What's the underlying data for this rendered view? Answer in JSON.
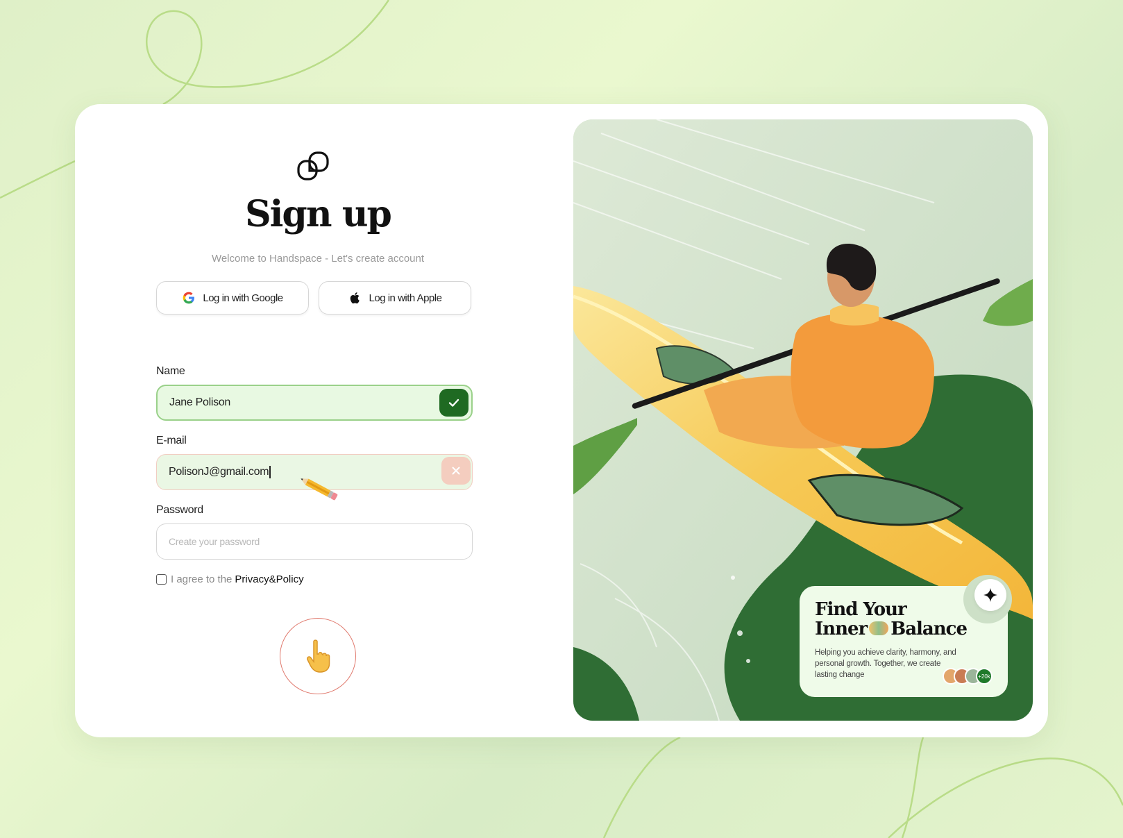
{
  "app": {
    "title": "Sign up",
    "subtitle": "Welcome to Handspace - Let's create account"
  },
  "social": {
    "google_label": "Log in with Google",
    "apple_label": "Log in with Apple"
  },
  "form": {
    "name": {
      "label": "Name",
      "value": "Jane Polison",
      "status": "valid"
    },
    "email": {
      "label": "E-mail",
      "value": "PolisonJ@gmail.com",
      "status": "invalid"
    },
    "password": {
      "label": "Password",
      "placeholder": "Create your password",
      "value": ""
    },
    "agree": {
      "prefix": "I agree to the ",
      "link": "Privacy&Policy",
      "checked": false
    }
  },
  "promo": {
    "title_line1": "Find Your",
    "title_line2_a": "Inner",
    "title_line2_b": "Balance",
    "text": "Helping you achieve clarity, harmony, and personal growth. Together, we create lasting change",
    "avatar_count": "+20k"
  },
  "icons": {
    "logo": "linked-squares-logo-icon",
    "google": "google-icon",
    "apple": "apple-icon",
    "valid": "check-icon",
    "invalid": "close-icon",
    "submit": "pointing-hand-icon",
    "cursor": "pencil-icon",
    "promo_action": "sparkle-icon"
  },
  "colors": {
    "accent_green": "#1f6a22",
    "valid_bg": "#e8f9e2",
    "invalid_border": "#f1cdc2",
    "submit_ring": "#e07a6e"
  }
}
